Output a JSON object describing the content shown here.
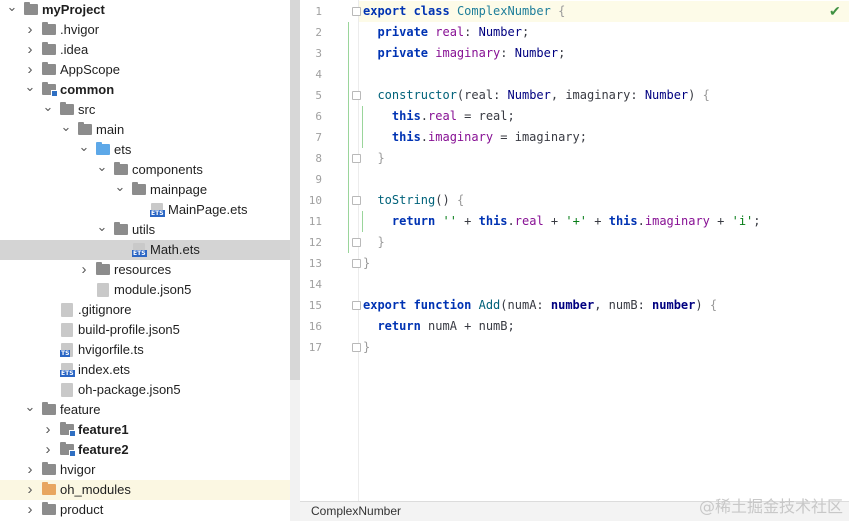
{
  "tree": {
    "items": [
      {
        "label": "myProject",
        "bold": true,
        "depth": 0,
        "expanded": true,
        "icon": "folder"
      },
      {
        "label": ".hvigor",
        "depth": 1,
        "expanded": false,
        "icon": "folder"
      },
      {
        "label": ".idea",
        "depth": 1,
        "expanded": false,
        "icon": "folder"
      },
      {
        "label": "AppScope",
        "depth": 1,
        "expanded": false,
        "icon": "folder"
      },
      {
        "label": "common",
        "bold": true,
        "depth": 1,
        "expanded": true,
        "icon": "folder-module"
      },
      {
        "label": "src",
        "depth": 2,
        "expanded": true,
        "icon": "folder"
      },
      {
        "label": "main",
        "depth": 3,
        "expanded": true,
        "icon": "folder"
      },
      {
        "label": "ets",
        "depth": 4,
        "expanded": true,
        "icon": "folder-blue"
      },
      {
        "label": "components",
        "depth": 5,
        "expanded": true,
        "icon": "folder"
      },
      {
        "label": "mainpage",
        "depth": 6,
        "expanded": true,
        "icon": "folder"
      },
      {
        "label": "MainPage.ets",
        "depth": 7,
        "icon": "file-ets"
      },
      {
        "label": "utils",
        "depth": 5,
        "expanded": true,
        "icon": "folder"
      },
      {
        "label": "Math.ets",
        "depth": 6,
        "icon": "file-ets",
        "selected": true
      },
      {
        "label": "resources",
        "depth": 4,
        "expanded": false,
        "icon": "folder"
      },
      {
        "label": "module.json5",
        "depth": 4,
        "icon": "file-json"
      },
      {
        "label": ".gitignore",
        "depth": 2,
        "icon": "file-generic"
      },
      {
        "label": "build-profile.json5",
        "depth": 2,
        "icon": "file-json"
      },
      {
        "label": "hvigorfile.ts",
        "depth": 2,
        "icon": "file-ts"
      },
      {
        "label": "index.ets",
        "depth": 2,
        "icon": "file-ets"
      },
      {
        "label": "oh-package.json5",
        "depth": 2,
        "icon": "file-json"
      },
      {
        "label": "feature",
        "depth": 1,
        "expanded": true,
        "icon": "folder"
      },
      {
        "label": "feature1",
        "bold": true,
        "depth": 2,
        "expanded": false,
        "icon": "folder-module"
      },
      {
        "label": "feature2",
        "bold": true,
        "depth": 2,
        "expanded": false,
        "icon": "folder-module"
      },
      {
        "label": "hvigor",
        "depth": 1,
        "expanded": false,
        "icon": "folder"
      },
      {
        "label": "oh_modules",
        "depth": 1,
        "expanded": false,
        "icon": "folder-orange",
        "highlight": true
      },
      {
        "label": "product",
        "depth": 1,
        "expanded": false,
        "icon": "folder"
      }
    ]
  },
  "editor": {
    "status_icon": "check-icon",
    "lines": [
      [
        [
          "kw",
          "export "
        ],
        [
          "kw",
          "class "
        ],
        [
          "cls",
          "ComplexNumber "
        ],
        [
          "brace",
          "{"
        ]
      ],
      [
        [
          "kw",
          "  private "
        ],
        [
          "prop",
          "real"
        ],
        [
          "txt",
          ": "
        ],
        [
          "typ",
          "Number"
        ],
        [
          "txt",
          ";"
        ]
      ],
      [
        [
          "kw",
          "  private "
        ],
        [
          "prop",
          "imaginary"
        ],
        [
          "txt",
          ": "
        ],
        [
          "typ",
          "Number"
        ],
        [
          "txt",
          ";"
        ]
      ],
      [],
      [
        [
          "fn",
          "  constructor"
        ],
        [
          "txt",
          "("
        ],
        [
          "txt",
          "real"
        ],
        [
          "txt",
          ": "
        ],
        [
          "typ",
          "Number"
        ],
        [
          "txt",
          ", "
        ],
        [
          "txt",
          "imaginary"
        ],
        [
          "txt",
          ": "
        ],
        [
          "typ",
          "Number"
        ],
        [
          "txt",
          ") "
        ],
        [
          "brace",
          "{"
        ]
      ],
      [
        [
          "kw",
          "    this"
        ],
        [
          "txt",
          "."
        ],
        [
          "prop",
          "real"
        ],
        [
          "txt",
          " = real;"
        ]
      ],
      [
        [
          "kw",
          "    this"
        ],
        [
          "txt",
          "."
        ],
        [
          "prop",
          "imaginary"
        ],
        [
          "txt",
          " = imaginary;"
        ]
      ],
      [
        [
          "brace",
          "  }"
        ]
      ],
      [],
      [
        [
          "fn",
          "  toString"
        ],
        [
          "txt",
          "() "
        ],
        [
          "brace",
          "{"
        ]
      ],
      [
        [
          "kw",
          "    return "
        ],
        [
          "str",
          "''"
        ],
        [
          "txt",
          " + "
        ],
        [
          "kw",
          "this"
        ],
        [
          "txt",
          "."
        ],
        [
          "prop",
          "real"
        ],
        [
          "txt",
          " + "
        ],
        [
          "str",
          "'+'"
        ],
        [
          "txt",
          " + "
        ],
        [
          "kw",
          "this"
        ],
        [
          "txt",
          "."
        ],
        [
          "prop",
          "imaginary"
        ],
        [
          "txt",
          " + "
        ],
        [
          "str",
          "'i'"
        ],
        [
          "txt",
          ";"
        ]
      ],
      [
        [
          "brace",
          "  }"
        ]
      ],
      [
        [
          "brace",
          "}"
        ]
      ],
      [],
      [
        [
          "kw",
          "export "
        ],
        [
          "kw",
          "function "
        ],
        [
          "fn",
          "Add"
        ],
        [
          "txt",
          "(numA: "
        ],
        [
          "kw2",
          "number"
        ],
        [
          "txt",
          ", numB: "
        ],
        [
          "kw2",
          "number"
        ],
        [
          "txt",
          ") "
        ],
        [
          "brace",
          "{"
        ]
      ],
      [
        [
          "kw",
          "  return "
        ],
        [
          "txt",
          "numA + numB;"
        ]
      ],
      [
        [
          "brace",
          "}"
        ]
      ]
    ],
    "line_numbers": [
      "1",
      "2",
      "3",
      "4",
      "5",
      "6",
      "7",
      "8",
      "9",
      "10",
      "11",
      "12",
      "13",
      "14",
      "15",
      "16",
      "17"
    ]
  },
  "breadcrumb": {
    "label": "ComplexNumber"
  },
  "watermark": "@稀土掘金技术社区"
}
